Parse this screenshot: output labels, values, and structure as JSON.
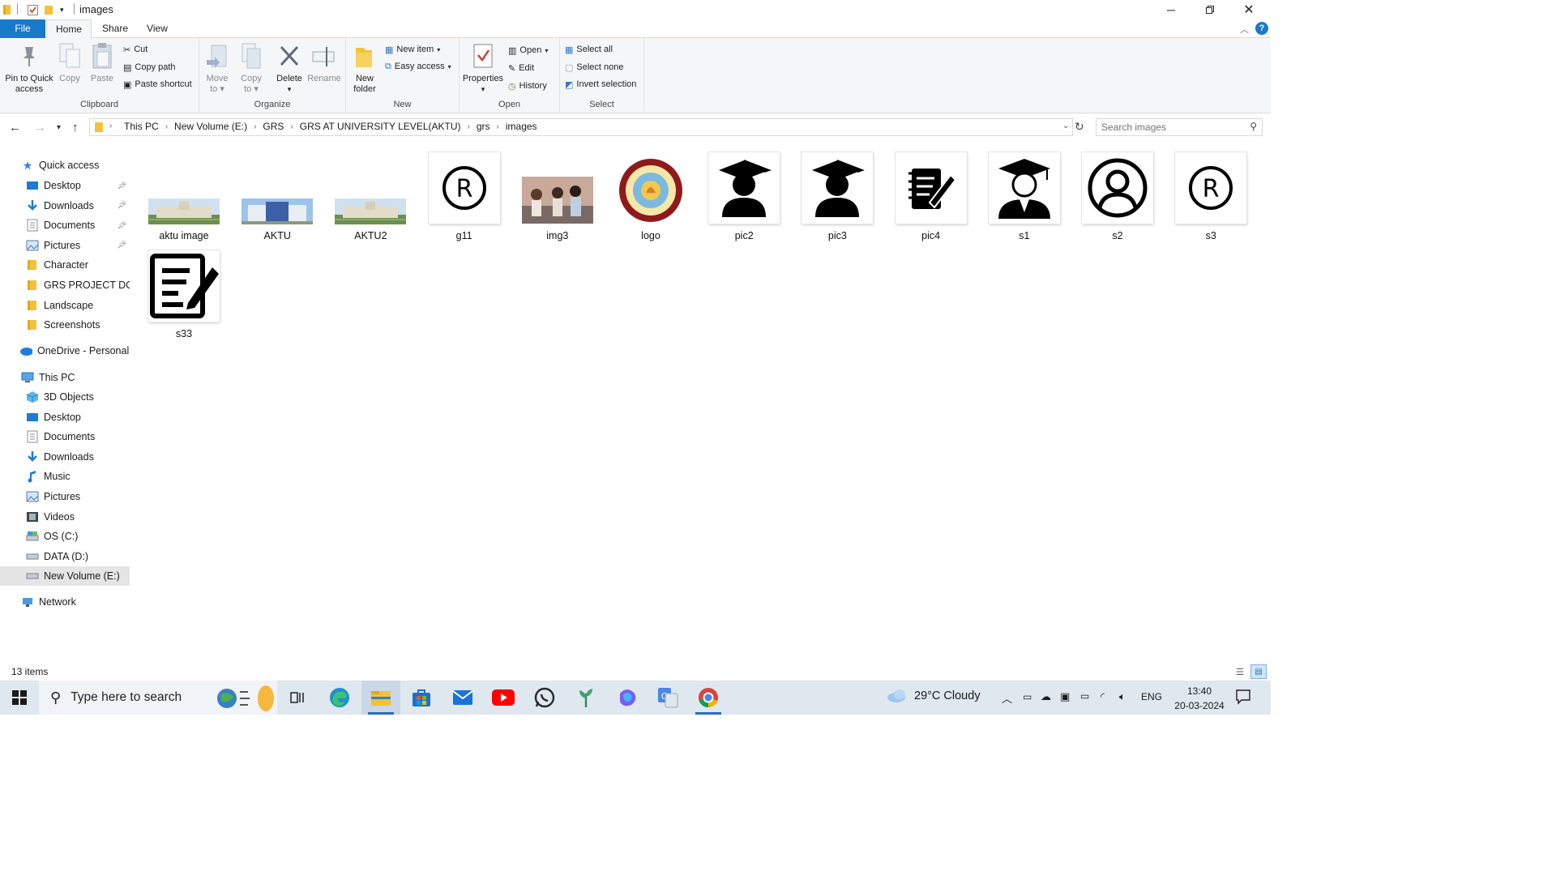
{
  "window": {
    "title": "images",
    "controls": {
      "minimize": "minimize-icon",
      "maximize": "restore-icon",
      "close": "close-icon"
    }
  },
  "ribbon_tabs": [
    "File",
    "Home",
    "Share",
    "View"
  ],
  "ribbon": {
    "clipboard": {
      "label": "Clipboard",
      "pin": "Pin to Quick\naccess",
      "pin_l1": "Pin to Quick",
      "pin_l2": "access",
      "copy": "Copy",
      "paste": "Paste",
      "cut": "Cut",
      "copy_path": "Copy path",
      "paste_shortcut": "Paste shortcut"
    },
    "organize": {
      "label": "Organize",
      "move_l1": "Move",
      "move_l2": "to",
      "copy_l1": "Copy",
      "copy_l2": "to",
      "delete": "Delete",
      "rename": "Rename"
    },
    "new": {
      "label": "New",
      "new_folder_l1": "New",
      "new_folder_l2": "folder",
      "new_item": "New item",
      "easy_access": "Easy access"
    },
    "open": {
      "label": "Open",
      "properties": "Properties",
      "open": "Open",
      "edit": "Edit",
      "history": "History"
    },
    "select": {
      "label": "Select",
      "select_all": "Select all",
      "select_none": "Select none",
      "invert": "Invert selection"
    }
  },
  "breadcrumb": [
    "This PC",
    "New Volume (E:)",
    "GRS",
    "GRS AT UNIVERSITY LEVEL(AKTU)",
    "grs",
    "images"
  ],
  "search": {
    "placeholder": "Search images"
  },
  "nav": {
    "quick_access": "Quick access",
    "quick_items": [
      {
        "label": "Desktop",
        "icon": "desktop-icon",
        "pinned": true
      },
      {
        "label": "Downloads",
        "icon": "downloads-icon",
        "pinned": true
      },
      {
        "label": "Documents",
        "icon": "documents-icon",
        "pinned": true
      },
      {
        "label": "Pictures",
        "icon": "pictures-icon",
        "pinned": true
      },
      {
        "label": "Character",
        "icon": "folder-icon",
        "pinned": false
      },
      {
        "label": "GRS PROJECT DOCU",
        "icon": "folder-icon",
        "pinned": false
      },
      {
        "label": "Landscape",
        "icon": "folder-icon",
        "pinned": false
      },
      {
        "label": "Screenshots",
        "icon": "folder-icon",
        "pinned": false
      }
    ],
    "onedrive": "OneDrive - Personal",
    "this_pc": "This PC",
    "pc_items": [
      {
        "label": "3D Objects",
        "icon": "3d-objects-icon"
      },
      {
        "label": "Desktop",
        "icon": "desktop-icon"
      },
      {
        "label": "Documents",
        "icon": "documents-icon"
      },
      {
        "label": "Downloads",
        "icon": "downloads-icon"
      },
      {
        "label": "Music",
        "icon": "music-icon"
      },
      {
        "label": "Pictures",
        "icon": "pictures-icon"
      },
      {
        "label": "Videos",
        "icon": "videos-icon"
      },
      {
        "label": "OS (C:)",
        "icon": "os-drive-icon"
      },
      {
        "label": "DATA (D:)",
        "icon": "drive-icon"
      },
      {
        "label": "New Volume (E:)",
        "icon": "drive-icon",
        "selected": true
      }
    ],
    "network": "Network"
  },
  "files": [
    {
      "name": "aktu image",
      "kind": "photo-campus"
    },
    {
      "name": "AKTU",
      "kind": "photo-building"
    },
    {
      "name": "AKTU2",
      "kind": "photo-campus"
    },
    {
      "name": "g11",
      "kind": "registered-symbol"
    },
    {
      "name": "img3",
      "kind": "photo-students"
    },
    {
      "name": "logo",
      "kind": "university-logo"
    },
    {
      "name": "pic2",
      "kind": "graduate-silhouette"
    },
    {
      "name": "pic3",
      "kind": "graduate-silhouette"
    },
    {
      "name": "pic4",
      "kind": "notepad-pen"
    },
    {
      "name": "s1",
      "kind": "graduate-suit"
    },
    {
      "name": "s2",
      "kind": "user-circle"
    },
    {
      "name": "s3",
      "kind": "registered-symbol"
    },
    {
      "name": "s33",
      "kind": "document-edit"
    }
  ],
  "status": {
    "item_count": "13 items"
  },
  "taskbar": {
    "search_placeholder": "Type here to search",
    "weather": "29°C  Cloudy",
    "language": "ENG",
    "time": "13:40",
    "date": "20-03-2024",
    "apps": [
      "edge-icon",
      "file-explorer-icon",
      "store-icon",
      "mail-icon",
      "youtube-icon",
      "whatsapp-icon",
      "plant-app-icon",
      "copilot-icon",
      "translate-icon",
      "chrome-icon"
    ]
  }
}
